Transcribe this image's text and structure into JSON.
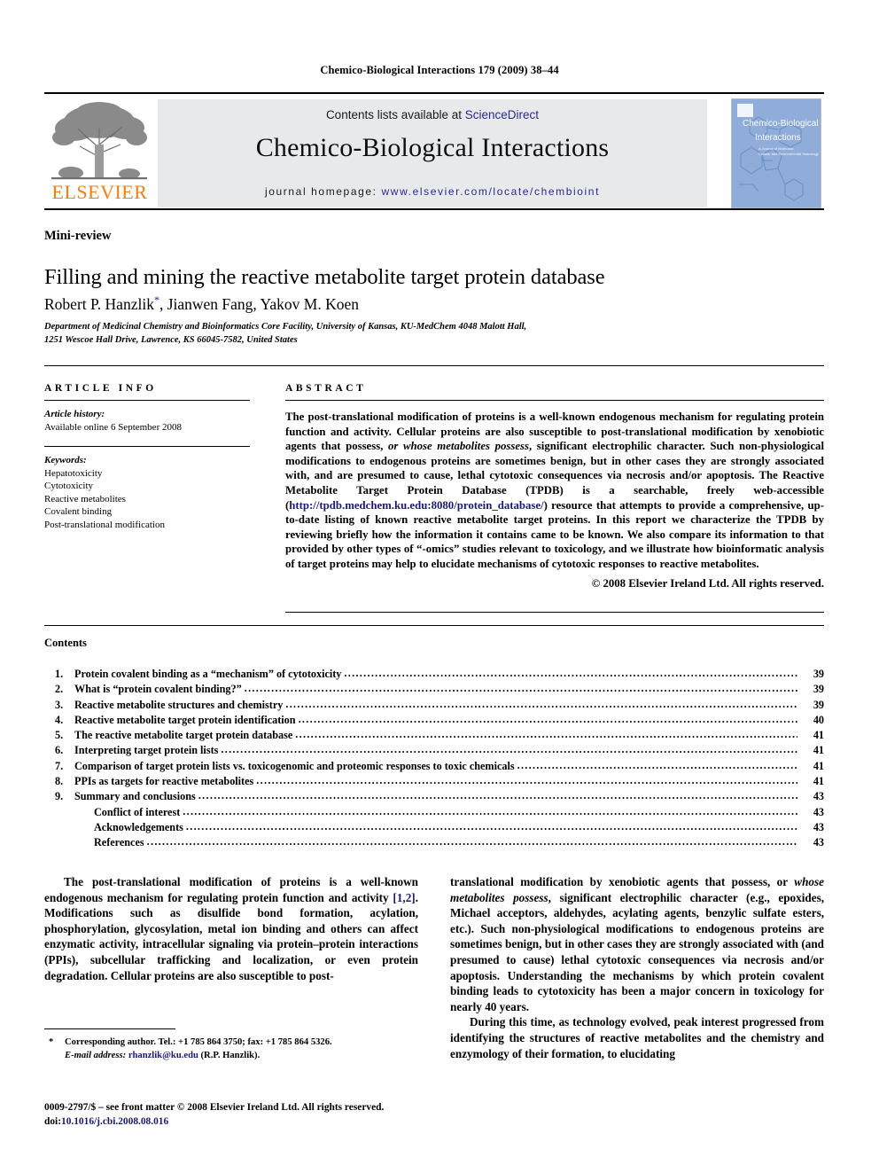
{
  "running_head": "Chemico-Biological Interactions 179 (2009) 38–44",
  "masthead": {
    "publisher_name": "ELSEVIER",
    "contents_prefix": "Contents lists available at ",
    "contents_link": "ScienceDirect",
    "journal_title": "Chemico-Biological Interactions",
    "homepage_label": "journal homepage: ",
    "homepage_url": "www.elsevier.com/locate/chembioint",
    "cover_title_line1": "Chemico-Biological",
    "cover_title_line2": "Interactions",
    "cover_subtitle": "A Journal of Molecular, Cellular and Environmental Toxicology"
  },
  "article": {
    "kicker": "Mini-review",
    "title": "Filling and mining the reactive metabolite target protein database",
    "authors": "Robert P. Hanzlik",
    "authors_rest": ", Jianwen Fang, Yakov M. Koen",
    "corresponding_marker": "*",
    "affiliation_line1": "Department of Medicinal Chemistry and Bioinformatics Core Facility, University of Kansas, KU-MedChem 4048 Malott Hall,",
    "affiliation_line2": "1251 Wescoe Hall Drive, Lawrence, KS 66045-7582, United States"
  },
  "article_info": {
    "heading": "ARTICLE INFO",
    "history_label": "Article history:",
    "history_value": "Available online 6 September 2008",
    "keywords_label": "Keywords:",
    "keywords": [
      "Hepatotoxicity",
      "Cytotoxicity",
      "Reactive metabolites",
      "Covalent binding",
      "Post-translational modification"
    ]
  },
  "abstract": {
    "heading": "ABSTRACT",
    "part1": "The post-translational modification of proteins is a well-known endogenous mechanism for regulating protein function and activity. Cellular proteins are also susceptible to post-translational modification by xenobiotic agents that possess, ",
    "italic1": "or whose metabolites possess",
    "part2": ", significant electrophilic character. Such non-physiological modifications to endogenous proteins are sometimes benign, but in other cases they are strongly associated with, and are presumed to cause, lethal cytotoxic consequences via necrosis and/or apoptosis. The Reactive Metabolite Target Protein Database (TPDB) is a searchable, freely web-accessible (",
    "url": "http://tpdb.medchem.ku.edu:8080/protein_database/",
    "part3": ") resource that attempts to provide a comprehensive, up-to-date listing of known reactive metabolite target proteins. In this report we characterize the TPDB by reviewing briefly how the information it contains came to be known. We also compare its information to that provided by other types of “-omics” studies relevant to toxicology, and we illustrate how bioinformatic analysis of target proteins may help to elucidate mechanisms of cytotoxic responses to reactive metabolites.",
    "copyright": "© 2008 Elsevier Ireland Ltd. All rights reserved."
  },
  "contents": {
    "heading": "Contents",
    "items": [
      {
        "num": "1.",
        "label": "Protein covalent binding as a “mechanism” of cytotoxicity",
        "page": "39",
        "sub": false
      },
      {
        "num": "2.",
        "label": "What is “protein covalent binding?”",
        "page": "39",
        "sub": false
      },
      {
        "num": "3.",
        "label": "Reactive metabolite structures and chemistry",
        "page": "39",
        "sub": false
      },
      {
        "num": "4.",
        "label": "Reactive metabolite target protein identification",
        "page": "40",
        "sub": false
      },
      {
        "num": "5.",
        "label": "The reactive metabolite target protein database",
        "page": "41",
        "sub": false
      },
      {
        "num": "6.",
        "label": "Interpreting target protein lists",
        "page": "41",
        "sub": false
      },
      {
        "num": "7.",
        "label": "Comparison of target protein lists vs. toxicogenomic and proteomic responses to toxic chemicals",
        "page": "41",
        "sub": false
      },
      {
        "num": "8.",
        "label": "PPIs as targets for reactive metabolites",
        "page": "41",
        "sub": false
      },
      {
        "num": "9.",
        "label": "Summary and conclusions",
        "page": "43",
        "sub": false
      },
      {
        "num": "",
        "label": "Conflict of interest",
        "page": "43",
        "sub": true
      },
      {
        "num": "",
        "label": "Acknowledgements",
        "page": "43",
        "sub": true
      },
      {
        "num": "",
        "label": "References",
        "page": "43",
        "sub": true
      }
    ]
  },
  "body": {
    "left_para1_a": "The post-translational modification of proteins is a well-known endogenous mechanism for regulating protein function and activity ",
    "left_para1_ref": "[1,2]",
    "left_para1_b": ". Modifications such as disulfide bond formation, acylation, phosphorylation, glycosylation, metal ion binding and others can affect enzymatic activity, intracellular signaling via protein–protein interactions (PPIs), subcellular trafficking and localization, or even protein degradation. Cellular proteins are also susceptible to post-",
    "right_para1_a": "translational modification by xenobiotic agents that possess, or ",
    "right_para1_ital": "whose metabolites possess",
    "right_para1_b": ", significant electrophilic character (e.g., epoxides, Michael acceptors, aldehydes, acylating agents, benzylic sulfate esters, etc.). Such non-physiological modifications to endogenous proteins are sometimes benign, but in other cases they are strongly associated with (and presumed to cause) lethal cytotoxic consequences via necrosis and/or apoptosis. Understanding the mechanisms by which protein covalent binding leads to cytotoxicity has been a major concern in toxicology for nearly 40 years.",
    "right_para2": "During this time, as technology evolved, peak interest progressed from identifying the structures of reactive metabolites and the chemistry and enzymology of their formation, to elucidating"
  },
  "footnote": {
    "marker": "*",
    "corresponding": "Corresponding author. Tel.: +1 785 864 3750; fax: +1 785 864 5326.",
    "email_label": "E-mail address:",
    "email": "rhanzlik@ku.edu",
    "email_attrib": "(R.P. Hanzlik)."
  },
  "imprint": {
    "line1": "0009-2797/$ – see front matter © 2008 Elsevier Ireland Ltd. All rights reserved.",
    "doi_label": "doi:",
    "doi_value": "10.1016/j.cbi.2008.08.016"
  },
  "colors": {
    "elsevier_orange": "#F07F13",
    "link_blue": "#2b2b8f",
    "dark_link": "#1b1b6e",
    "band_gray": "#e8e9eb",
    "cover_blue": "#7f9fd0"
  }
}
